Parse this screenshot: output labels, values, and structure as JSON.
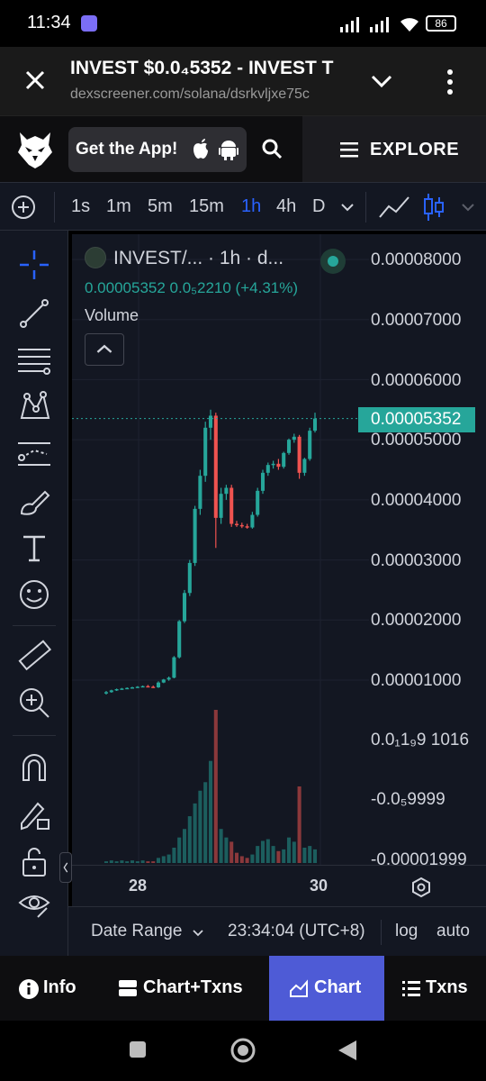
{
  "status_bar": {
    "time": "11:34",
    "battery": "86"
  },
  "browser": {
    "title": "INVEST $0.0₄5352 - INVEST T",
    "url": "dexscreener.com/solana/dsrkvljxe75c"
  },
  "site_header": {
    "get_app_label": "Get the App!",
    "explore_label": "EXPLORE"
  },
  "toolbar": {
    "timeframes": [
      "1s",
      "1m",
      "5m",
      "15m",
      "1h",
      "4h",
      "D"
    ],
    "active_timeframe": "1h"
  },
  "legend": {
    "symbol_line": "INVEST/... · 1h · d...",
    "price_line": "0.00005352  0.0₅2210 (+4.31%)",
    "volume_label": "Volume"
  },
  "price_axis": {
    "labels": [
      "0.00008000",
      "0.00007000",
      "0.00006000",
      "0.00005000",
      "0.00004000",
      "0.00003000",
      "0.00002000",
      "0.00001000",
      "0.0₁1₉9 1016",
      "-0.0₅9999",
      "-0.00001999"
    ],
    "current_price": "0.00005352"
  },
  "time_axis": {
    "labels": [
      "28",
      "30"
    ]
  },
  "bottom_bar": {
    "date_range": "Date Range",
    "clock": "23:34:04 (UTC+8)",
    "log": "log",
    "auto": "auto"
  },
  "tabs": {
    "info": "Info",
    "chart_txns": "Chart+Txns",
    "chart": "Chart",
    "txns": "Txns",
    "active": "Chart"
  },
  "colors": {
    "up": "#26a69a",
    "down": "#ef5350",
    "accent": "#2962ff",
    "active_tab": "#4e5bd6"
  },
  "chart_data": {
    "type": "candlestick",
    "pair": "INVEST/SOL",
    "interval": "1h",
    "ylim": [
      -2e-05,
      8e-05
    ],
    "y_ticks": [
      8e-05,
      7e-05,
      6e-05,
      5e-05,
      4e-05,
      3e-05,
      2e-05,
      1e-05
    ],
    "last_price": 5.352e-05,
    "candles": [
      {
        "o": 7.8e-06,
        "h": 8.2e-06,
        "l": 7.6e-06,
        "c": 8e-06
      },
      {
        "o": 8e-06,
        "h": 8.4e-06,
        "l": 7.9e-06,
        "c": 8.3e-06
      },
      {
        "o": 8.3e-06,
        "h": 8.6e-06,
        "l": 8.2e-06,
        "c": 8.5e-06
      },
      {
        "o": 8.5e-06,
        "h": 8.7e-06,
        "l": 8.4e-06,
        "c": 8.6e-06
      },
      {
        "o": 8.6e-06,
        "h": 8.8e-06,
        "l": 8.5e-06,
        "c": 8.7e-06
      },
      {
        "o": 8.7e-06,
        "h": 8.9e-06,
        "l": 8.6e-06,
        "c": 8.8e-06
      },
      {
        "o": 8.8e-06,
        "h": 9e-06,
        "l": 8.7e-06,
        "c": 8.9e-06
      },
      {
        "o": 8.9e-06,
        "h": 9.1e-06,
        "l": 8.8e-06,
        "c": 9e-06
      },
      {
        "o": 9e-06,
        "h": 9.2e-06,
        "l": 8.8e-06,
        "c": 8.9e-06
      },
      {
        "o": 8.9e-06,
        "h": 9.1e-06,
        "l": 8.7e-06,
        "c": 8.8e-06
      },
      {
        "o": 8.8e-06,
        "h": 9.8e-06,
        "l": 8.7e-06,
        "c": 9.6e-06
      },
      {
        "o": 9.6e-06,
        "h": 1.02e-05,
        "l": 9.5e-06,
        "c": 1.01e-05
      },
      {
        "o": 1.01e-05,
        "h": 1.06e-05,
        "l": 9.9e-06,
        "c": 1.04e-05
      },
      {
        "o": 1.04e-05,
        "h": 1.4e-05,
        "l": 1.03e-05,
        "c": 1.38e-05
      },
      {
        "o": 1.38e-05,
        "h": 2e-05,
        "l": 1.36e-05,
        "c": 1.98e-05
      },
      {
        "o": 1.98e-05,
        "h": 2.5e-05,
        "l": 1.95e-05,
        "c": 2.45e-05
      },
      {
        "o": 2.45e-05,
        "h": 3e-05,
        "l": 2.4e-05,
        "c": 2.95e-05
      },
      {
        "o": 2.95e-05,
        "h": 3.9e-05,
        "l": 2.9e-05,
        "c": 3.85e-05
      },
      {
        "o": 3.85e-05,
        "h": 4.5e-05,
        "l": 3.75e-05,
        "c": 4.4e-05
      },
      {
        "o": 4.4e-05,
        "h": 5.3e-05,
        "l": 4.3e-05,
        "c": 5.2e-05
      },
      {
        "o": 5.2e-05,
        "h": 5.5e-05,
        "l": 5e-05,
        "c": 5.4e-05
      },
      {
        "o": 5.4e-05,
        "h": 5.45e-05,
        "l": 3.2e-05,
        "c": 3.7e-05
      },
      {
        "o": 3.7e-05,
        "h": 4.2e-05,
        "l": 3.6e-05,
        "c": 4.1e-05
      },
      {
        "o": 4.1e-05,
        "h": 4.25e-05,
        "l": 4e-05,
        "c": 4.2e-05
      },
      {
        "o": 4.2e-05,
        "h": 4.25e-05,
        "l": 3.55e-05,
        "c": 3.6e-05
      },
      {
        "o": 3.6e-05,
        "h": 3.65e-05,
        "l": 3.55e-05,
        "c": 3.58e-05
      },
      {
        "o": 3.58e-05,
        "h": 3.62e-05,
        "l": 3.53e-05,
        "c": 3.56e-05
      },
      {
        "o": 3.56e-05,
        "h": 3.6e-05,
        "l": 3.52e-05,
        "c": 3.54e-05
      },
      {
        "o": 3.54e-05,
        "h": 3.8e-05,
        "l": 3.52e-05,
        "c": 3.75e-05
      },
      {
        "o": 3.75e-05,
        "h": 4.2e-05,
        "l": 3.72e-05,
        "c": 4.15e-05
      },
      {
        "o": 4.15e-05,
        "h": 4.5e-05,
        "l": 4.1e-05,
        "c": 4.45e-05
      },
      {
        "o": 4.45e-05,
        "h": 4.62e-05,
        "l": 4.4e-05,
        "c": 4.58e-05
      },
      {
        "o": 4.58e-05,
        "h": 4.65e-05,
        "l": 4.52e-05,
        "c": 4.6e-05
      },
      {
        "o": 4.6e-05,
        "h": 4.68e-05,
        "l": 4.5e-05,
        "c": 4.55e-05
      },
      {
        "o": 4.55e-05,
        "h": 4.8e-05,
        "l": 4.52e-05,
        "c": 4.78e-05
      },
      {
        "o": 4.78e-05,
        "h": 5.02e-05,
        "l": 4.75e-05,
        "c": 5e-05
      },
      {
        "o": 5e-05,
        "h": 5.1e-05,
        "l": 4.95e-05,
        "c": 5.05e-05
      },
      {
        "o": 5.05e-05,
        "h": 5.08e-05,
        "l": 4.35e-05,
        "c": 4.45e-05
      },
      {
        "o": 4.45e-05,
        "h": 4.7e-05,
        "l": 4.4e-05,
        "c": 4.68e-05
      },
      {
        "o": 4.68e-05,
        "h": 5.2e-05,
        "l": 4.65e-05,
        "c": 5.15e-05
      },
      {
        "o": 5.15e-05,
        "h": 5.45e-05,
        "l": 5.12e-05,
        "c": 5.352e-05
      }
    ],
    "volumes": [
      2,
      3,
      2,
      3,
      2,
      3,
      2,
      3,
      2,
      2,
      6,
      8,
      10,
      18,
      30,
      40,
      55,
      70,
      85,
      95,
      120,
      180,
      40,
      30,
      25,
      12,
      8,
      6,
      10,
      20,
      26,
      28,
      20,
      14,
      16,
      30,
      25,
      90,
      18,
      20,
      16
    ],
    "x_tick_labels": [
      "28",
      "30"
    ]
  }
}
